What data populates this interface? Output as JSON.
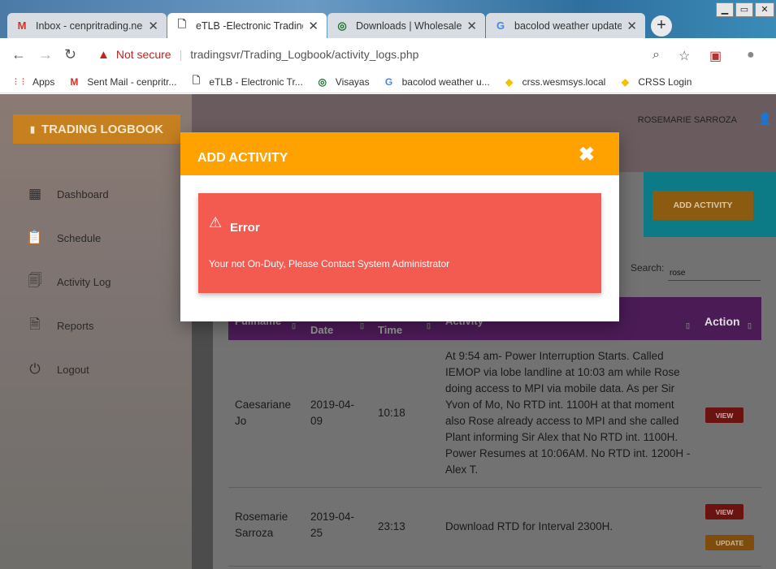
{
  "browser": {
    "tabs": [
      {
        "icon": "gmail-icon",
        "glyph": "M",
        "title": "Inbox - cenpritrading.neg",
        "active": false
      },
      {
        "icon": "page-icon",
        "glyph": "🗋",
        "title": "eTLB -Electronic Trading",
        "active": true
      },
      {
        "icon": "globe-icon",
        "glyph": "◎",
        "title": "Downloads | Wholesale E",
        "active": false
      },
      {
        "icon": "google-icon",
        "glyph": "G",
        "title": "bacolod weather update",
        "active": false
      }
    ],
    "tab_close": "✕",
    "new_tab": "+",
    "window": {
      "minimize": "▁",
      "maximize": "▭",
      "close": "✕"
    },
    "security_label": "Not secure",
    "url": "tradingsvr/Trading_Logbook/activity_logs.php",
    "bookmarks": [
      {
        "icon": "apps-icon",
        "glyph": "⋮⋮",
        "label": "Apps"
      },
      {
        "icon": "gmail-icon",
        "glyph": "M",
        "label": "Sent Mail - cenpritr..."
      },
      {
        "icon": "page-icon",
        "glyph": "🗋",
        "label": "eTLB - Electronic Tr..."
      },
      {
        "icon": "globe-icon",
        "glyph": "◎",
        "label": "Visayas"
      },
      {
        "icon": "google-icon",
        "glyph": "G",
        "label": "bacolod weather u..."
      },
      {
        "icon": "diamond-icon",
        "glyph": "◆",
        "label": "crss.wesmsys.local"
      },
      {
        "icon": "diamond-icon",
        "glyph": "◆",
        "label": "CRSS Login"
      }
    ]
  },
  "app": {
    "brand": "TRADING LOGBOOK",
    "nav": [
      {
        "id": "dashboard",
        "label": "Dashboard",
        "glyph": "▦"
      },
      {
        "id": "schedule",
        "label": "Schedule",
        "glyph": "📋"
      },
      {
        "id": "activity-log",
        "label": "Activity Log",
        "glyph": "🗐"
      },
      {
        "id": "reports",
        "label": "Reports",
        "glyph": "🗎"
      },
      {
        "id": "logout",
        "label": "Logout",
        "glyph": "⏻"
      }
    ],
    "user_name": "ROSEMARIE SARROZA",
    "add_activity_label": "ADD ACTIVITY",
    "search_label": "Search:",
    "search_value": "rose",
    "table": {
      "headers": [
        "Fullname",
        "Date",
        "Time",
        "Activity",
        "Action"
      ],
      "rows": [
        {
          "fullname": "Caesariane Jo",
          "date": "2019-04-09",
          "time": "10:18",
          "activity": "At 9:54 am- Power Interruption Starts. Called IEMOP via lobe landline at 10:03 am while Rose doing access to MPI via mobile data. As per Sir Yvon of Mo, No RTD int. 1100H at that moment also Rose already access to MPI and she called Plant informing Sir Alex that No RTD int. 1100H. Power Resumes at 10:06AM. No RTD int. 1200H - Alex T.",
          "actions": [
            "VIEW"
          ]
        },
        {
          "fullname": "Rosemarie Sarroza",
          "date": "2019-04-25",
          "time": "23:13",
          "activity": "Download RTD for Interval 2300H.",
          "actions": [
            "VIEW",
            "UPDATE"
          ]
        }
      ]
    }
  },
  "modal": {
    "title": "ADD ACTIVITY",
    "close": "✖",
    "alert_icon": "⚠",
    "alert_title": "Error",
    "alert_message": "Your not On-Duty, Please Contact System Administrator"
  }
}
